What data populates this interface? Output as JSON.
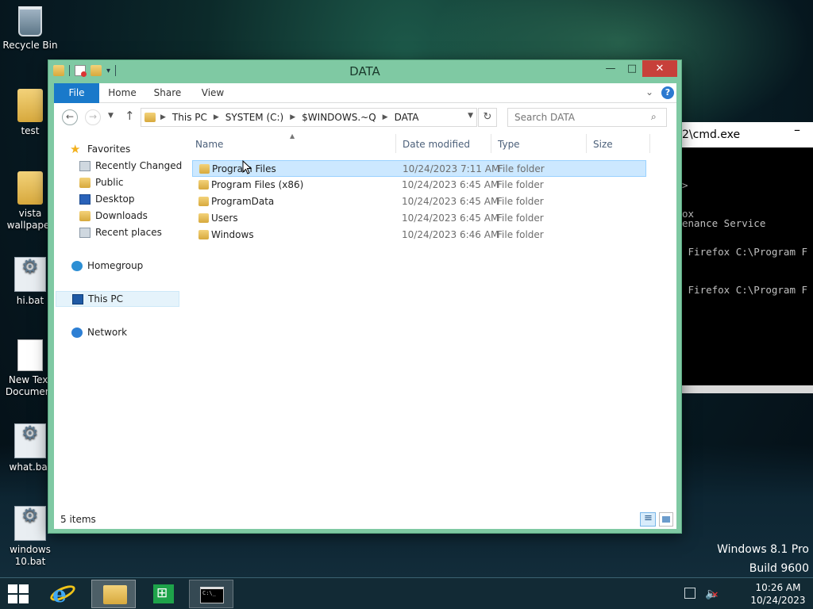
{
  "desktop": {
    "icons": [
      {
        "label": "Recycle Bin"
      },
      {
        "label": "test"
      },
      {
        "label": "vista wallpaper"
      },
      {
        "label": "hi.bat"
      },
      {
        "label": "New Text Document"
      },
      {
        "label": "what.bat"
      },
      {
        "label": "windows 10.bat"
      }
    ],
    "watermark": {
      "line1": "Windows 8.1 Pro",
      "line2": "Build 9600"
    }
  },
  "cmd_window": {
    "title": "2\\cmd.exe",
    "lines": [
      "",
      "",
      "",
      ">",
      "",
      "",
      "ox",
      "enance Service",
      "",
      "",
      " Firefox C:\\Program F",
      "",
      "",
      "",
      " Firefox C:\\Program F"
    ]
  },
  "explorer": {
    "title": "DATA",
    "ribbon_tabs": {
      "file": "File",
      "home": "Home",
      "share": "Share",
      "view": "View"
    },
    "breadcrumbs": [
      "This PC",
      "SYSTEM (C:)",
      "$WINDOWS.~Q",
      "DATA"
    ],
    "search_placeholder": "Search DATA",
    "sidebar": {
      "favorites": "Favorites",
      "recently_changed": "Recently Changed",
      "public": "Public",
      "desktop": "Desktop",
      "downloads": "Downloads",
      "recent_places": "Recent places",
      "homegroup": "Homegroup",
      "this_pc": "This PC",
      "network": "Network"
    },
    "columns": {
      "name": "Name",
      "date": "Date modified",
      "type": "Type",
      "size": "Size"
    },
    "files": [
      {
        "name": "Program Files",
        "date": "10/24/2023 7:11 AM",
        "type": "File folder",
        "selected": true
      },
      {
        "name": "Program Files (x86)",
        "date": "10/24/2023 6:45 AM",
        "type": "File folder"
      },
      {
        "name": "ProgramData",
        "date": "10/24/2023 6:45 AM",
        "type": "File folder"
      },
      {
        "name": "Users",
        "date": "10/24/2023 6:45 AM",
        "type": "File folder"
      },
      {
        "name": "Windows",
        "date": "10/24/2023 6:46 AM",
        "type": "File folder"
      }
    ],
    "status": "5 items"
  },
  "taskbar": {
    "clock_time": "10:26 AM",
    "clock_date": "10/24/2023"
  },
  "colors": {
    "window_frame": "#7fc9a3",
    "file_tab": "#1979ca",
    "close_button": "#c7403a",
    "selection": "#cce8ff"
  }
}
